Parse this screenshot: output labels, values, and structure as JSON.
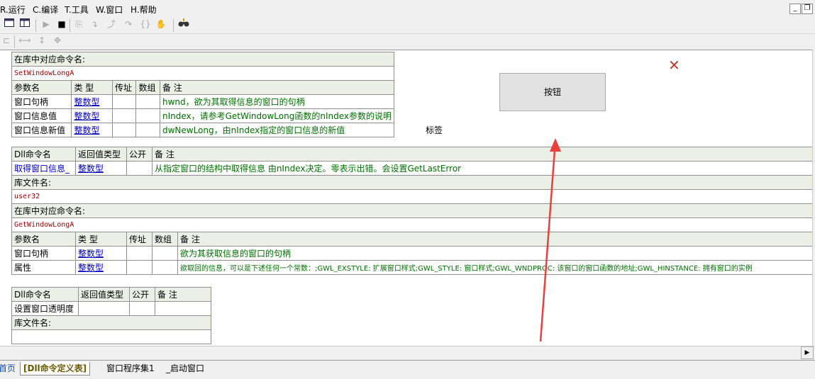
{
  "menu": {
    "items": [
      "R.运行",
      "C.编译",
      "T.工具",
      "W.窗口",
      "H.帮助"
    ],
    "min_glyph": "_",
    "restore_glyph": "❐"
  },
  "toolbar1_icons": [
    "window-layout-1-icon",
    "window-layout-2-icon",
    "run-icon",
    "stop-icon",
    "step-icon",
    "step-into-icon",
    "step-out-icon",
    "step-over-icon",
    "run-to-cursor-icon",
    "hand-icon",
    "find-icon"
  ],
  "toolbar2_icons": [
    "align-icon",
    "same-width-icon",
    "same-height-icon",
    "same-size-icon"
  ],
  "table1": {
    "lib_cmd_header": "在库中对应命令名:",
    "lib_cmd_value": "SetWindowLongA",
    "param_headers": [
      "参数名",
      "类 型",
      "传址",
      "数组",
      "备 注"
    ],
    "params": [
      {
        "name": "窗口句柄",
        "type": "整数型",
        "byref": "",
        "array": "",
        "note": "hwnd，欲为其取得信息的窗口的句柄"
      },
      {
        "name": "窗口信息值",
        "type": "整数型",
        "byref": "",
        "array": "",
        "note": "nIndex，请参考GetWindowLong函数的nIndex参数的说明"
      },
      {
        "name": "窗口信息新值",
        "type": "整数型",
        "byref": "",
        "array": "",
        "note": "dwNewLong，由nIndex指定的窗口信息的新值"
      }
    ]
  },
  "table2": {
    "cmd_headers": [
      "Dll命令名",
      "返回值类型",
      "公开",
      "备 注"
    ],
    "cmd": {
      "name": "取得窗口信息_",
      "ret": "整数型",
      "public": "",
      "note": "从指定窗口的结构中取得信息  由nIndex决定。零表示出错。会设置GetLastError"
    },
    "lib_file_header": "库文件名:",
    "lib_file_value": "user32",
    "lib_cmd_header": "在库中对应命令名:",
    "lib_cmd_value": "GetWindowLongA",
    "param_headers": [
      "参数名",
      "类 型",
      "传址",
      "数组",
      "备 注"
    ],
    "params": [
      {
        "name": "窗口句柄",
        "type": "整数型",
        "byref": "",
        "array": "",
        "note": "欲为其获取信息的窗口的句柄"
      },
      {
        "name": "属性",
        "type": "整数型",
        "byref": "",
        "array": "",
        "note": "欲取回的信息，可以是下述任何一个常数：;GWL_EXSTYLE: 扩展窗口样式;GWL_STYLE: 窗口样式;GWL_WNDPROC: 该窗口的窗口函数的地址;GWL_HINSTANCE: 拥有窗口的实例"
      }
    ]
  },
  "table3": {
    "cmd_headers": [
      "Dll命令名",
      "返回值类型",
      "公开",
      "备 注"
    ],
    "cmd": {
      "name": "设置窗口透明度",
      "ret": "",
      "public": "",
      "note": ""
    },
    "lib_file_header": "库文件名:",
    "lib_file_value": ""
  },
  "form": {
    "button_label": "按钮",
    "label_text": "标签",
    "close_glyph": "✕"
  },
  "tabs": [
    "首页",
    "[Dll命令定义表]",
    "窗口程序集1",
    "_启动窗口"
  ],
  "active_tab": 1,
  "colors": {
    "arrow": "#e8403a",
    "close": "#c0392b",
    "header_bg": "#eaf0e6",
    "note_green": "#007000",
    "lib_red": "#a00000"
  }
}
